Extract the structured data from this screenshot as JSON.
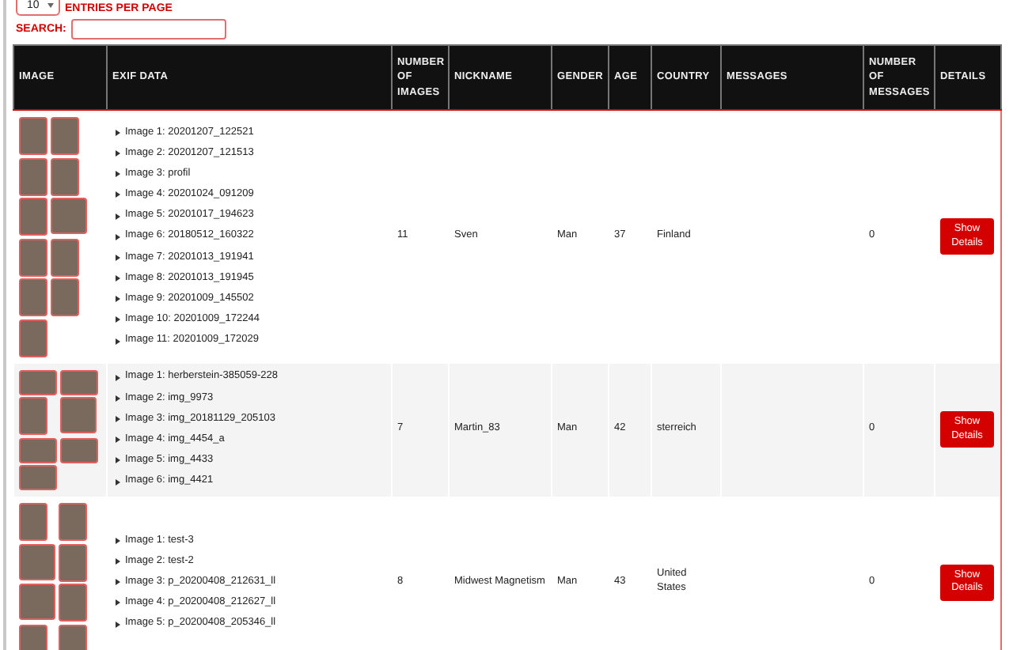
{
  "entries": {
    "value": "10",
    "label": "ENTRIES PER PAGE"
  },
  "search": {
    "label": "SEARCH:"
  },
  "table": {
    "columns": [
      "IMAGE",
      "EXIF DATA",
      "NUMBER OF IMAGES",
      "NICKNAME",
      "GENDER",
      "AGE",
      "COUNTRY",
      "MESSAGES",
      "NUMBER OF MESSAGES",
      "DETAILS"
    ],
    "rows": [
      {
        "thumbnails": [
          {
            "kind": "tall"
          },
          {
            "kind": "tall"
          },
          {
            "kind": "tall"
          },
          {
            "kind": "tall"
          },
          {
            "kind": "tall"
          },
          {
            "kind": "square"
          },
          {
            "kind": "tall"
          },
          {
            "kind": "tall"
          },
          {
            "kind": "tall"
          },
          {
            "kind": "tall"
          },
          {
            "kind": "tall"
          }
        ],
        "exif": [
          "Image 1: 20201207_122521",
          "Image 2: 20201207_121513",
          "Image 3: profil",
          "Image 4: 20201024_091209",
          "Image 5: 20201017_194623",
          "Image 6: 20180512_160322",
          "Image 7: 20201013_191941",
          "Image 8: 20201013_191945",
          "Image 9: 20201009_145502",
          "Image 10: 20201009_172244",
          "Image 11: 20201009_172029"
        ],
        "number_of_images": "11",
        "nickname": "Sven",
        "gender": "Man",
        "age": "37",
        "country": "Finland",
        "number_of_messages": "0",
        "details_button": "Show Details"
      },
      {
        "thumbnails": [
          {
            "kind": "wide"
          },
          {
            "kind": "wide"
          },
          {
            "kind": "tall"
          },
          {
            "kind": "square"
          },
          {
            "kind": "wide"
          },
          {
            "kind": "wide"
          },
          {
            "kind": "wide"
          }
        ],
        "exif": [
          "Image 1: herberstein-385059-228",
          "Image 2: img_9973",
          "Image 3: img_20181129_205103",
          "Image 4: img_4454_a",
          "Image 5: img_4433",
          "Image 6: img_4421"
        ],
        "number_of_images": "7",
        "nickname": "Martin_83",
        "gender": "Man",
        "age": "42",
        "country": "sterreich",
        "number_of_messages": "0",
        "details_button": "Show Details"
      },
      {
        "thumbnails": [
          {
            "kind": "tall"
          },
          {
            "kind": "tall"
          },
          {
            "kind": "square"
          },
          {
            "kind": "tall"
          },
          {
            "kind": "square"
          },
          {
            "kind": "tall"
          },
          {
            "kind": "tall"
          },
          {
            "kind": "tall"
          }
        ],
        "exif": [
          "Image 1: test-3",
          "Image 2: test-2",
          "Image 3: p_20200408_212631_ll",
          "Image 4: p_20200408_212627_ll",
          "Image 5: p_20200408_205346_ll"
        ],
        "number_of_images": "8",
        "nickname": "Midwest Magnetism",
        "gender": "Man",
        "age": "43",
        "country": "United States",
        "number_of_messages": "0",
        "details_button": "Show Details"
      }
    ]
  }
}
